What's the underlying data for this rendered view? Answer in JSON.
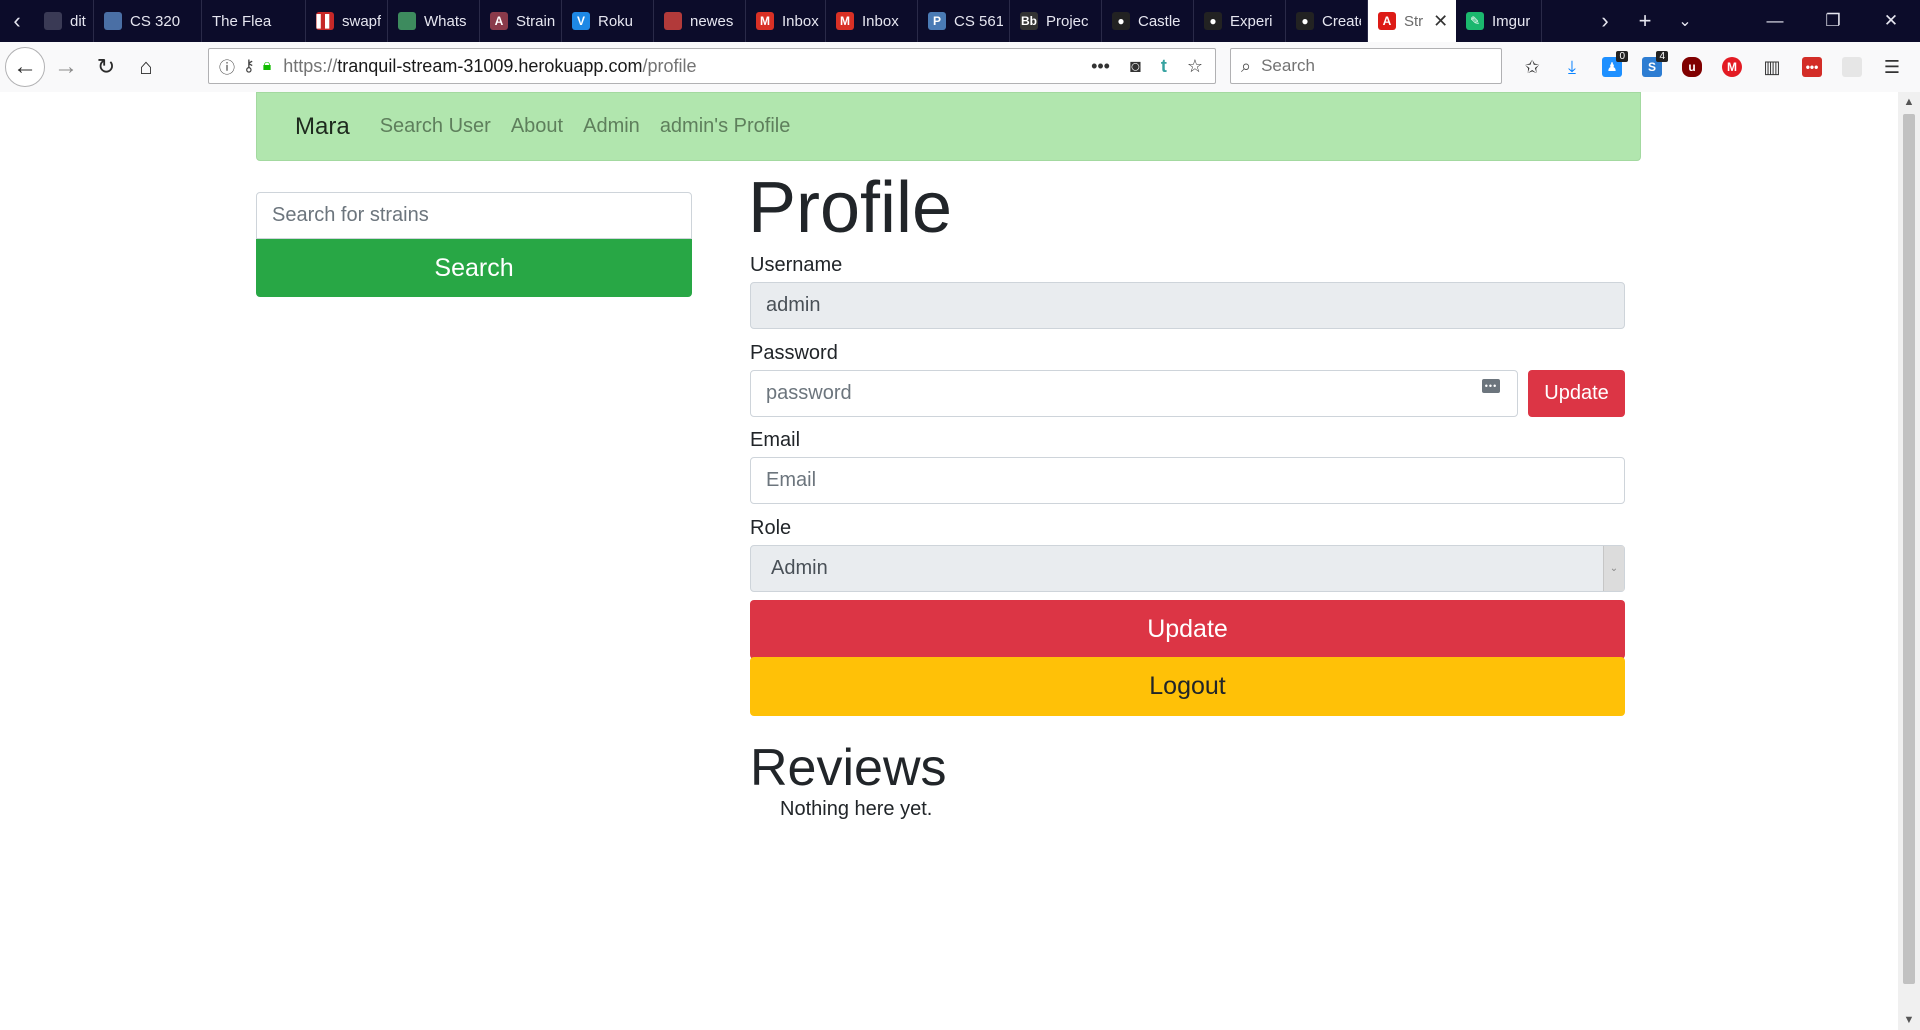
{
  "browser": {
    "tabs": [
      {
        "title": "dit",
        "favicon_color": "#3a3a55",
        "favicon_glyph": ""
      },
      {
        "title": "CS 320",
        "favicon_color": "#4a6fa5",
        "favicon_glyph": ""
      },
      {
        "title": "The Flea at",
        "favicon_color": "",
        "favicon_glyph": ""
      },
      {
        "title": "swapfo",
        "favicon_color": "#c62828",
        "favicon_glyph": "▌▌"
      },
      {
        "title": "Whats",
        "favicon_color": "#3d8b5e",
        "favicon_glyph": ""
      },
      {
        "title": "Strain",
        "favicon_color": "#8a3a4a",
        "favicon_glyph": "A"
      },
      {
        "title": "Roku",
        "favicon_color": "#1e88e5",
        "favicon_glyph": "V"
      },
      {
        "title": "newes",
        "favicon_color": "#b23a3a",
        "favicon_glyph": ""
      },
      {
        "title": "Inbox",
        "favicon_color": "#d93025",
        "favicon_glyph": "M"
      },
      {
        "title": "Inbox",
        "favicon_color": "#d93025",
        "favicon_glyph": "M"
      },
      {
        "title": "CS 561",
        "favicon_color": "#4a7bb5",
        "favicon_glyph": "P"
      },
      {
        "title": "Projec",
        "favicon_color": "#333333",
        "favicon_glyph": "Bb"
      },
      {
        "title": "Castle",
        "favicon_color": "#222222",
        "favicon_glyph": "●"
      },
      {
        "title": "Experi",
        "favicon_color": "#222222",
        "favicon_glyph": "●"
      },
      {
        "title": "Create",
        "favicon_color": "#222222",
        "favicon_glyph": "●"
      },
      {
        "title": "Str",
        "favicon_color": "#dd1b16",
        "favicon_glyph": "A",
        "active": true
      },
      {
        "title": "Imgur",
        "favicon_color": "#1bb76e",
        "favicon_glyph": "✎"
      }
    ],
    "url": {
      "prefix": "https://",
      "host": "tranquil-stream-31009.herokuapp.com",
      "path": "/profile"
    },
    "search_placeholder": "Search",
    "toolbar_badges": {
      "notifications": "0",
      "extension": "4"
    }
  },
  "site": {
    "brand": "Mara",
    "nav": [
      "Search User",
      "About",
      "Admin",
      "admin's Profile"
    ],
    "strain_search": {
      "placeholder": "Search for strains",
      "button": "Search"
    }
  },
  "profile": {
    "title": "Profile",
    "username": {
      "label": "Username",
      "value": "admin"
    },
    "password": {
      "label": "Password",
      "placeholder": "password",
      "button": "Update"
    },
    "email": {
      "label": "Email",
      "placeholder": "Email"
    },
    "role": {
      "label": "Role",
      "value": "Admin"
    },
    "update_button": "Update",
    "logout_button": "Logout"
  },
  "reviews": {
    "title": "Reviews",
    "empty_text": "Nothing here yet."
  },
  "colors": {
    "nav_bg": "#b1e6ae",
    "success": "#28a745",
    "danger": "#dc3545",
    "warning": "#ffc107"
  }
}
